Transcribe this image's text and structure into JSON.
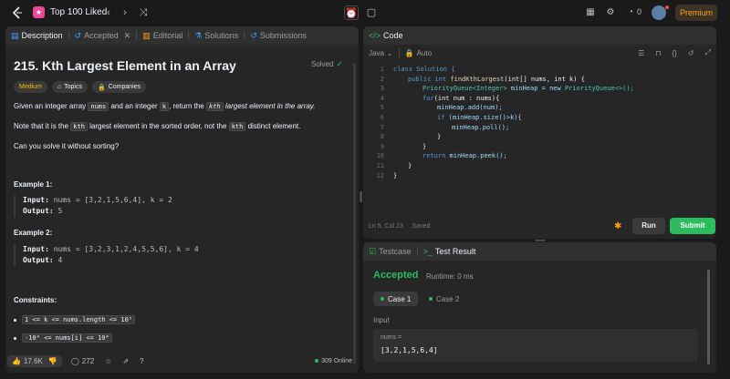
{
  "topbar": {
    "problem_list": "Top 100 Liked",
    "streak": "0",
    "premium": "Premium"
  },
  "description_panel": {
    "tabs": [
      "Description",
      "Accepted",
      "Editorial",
      "Solutions",
      "Submissions"
    ],
    "title": "215. Kth Largest Element in an Array",
    "status": "Solved",
    "tags": [
      "Medium",
      "Topics",
      "Companies"
    ],
    "para1": {
      "a": "Given an integer array ",
      "code1": "nums",
      "b": " and an integer ",
      "code2": "k",
      "c": ", return the ",
      "code3": "kth",
      "d": " largest element in the array."
    },
    "para2": {
      "a": "Note that it is the ",
      "code1": "kth",
      "b": " largest element in the sorted order, not the ",
      "code2": "kth",
      "c": " distinct element."
    },
    "para3": "Can you solve it without sorting?",
    "example1": {
      "heading": "Example 1:",
      "input_label": "Input:",
      "input": "nums = [3,2,1,5,6,4], k = 2",
      "output_label": "Output:",
      "output": "5"
    },
    "example2": {
      "heading": "Example 2:",
      "input_label": "Input:",
      "input": "nums = [3,2,3,1,2,4,5,5,6], k = 4",
      "output_label": "Output:",
      "output": "4"
    },
    "constraints_heading": "Constraints:",
    "constraints": [
      "1 <= k <= nums.length <= 10⁵",
      "-10⁴ <= nums[i] <= 10⁴"
    ],
    "likes": "17.6K",
    "comments": "272",
    "online": "309 Online"
  },
  "code_panel": {
    "tab": "Code",
    "language": "Java",
    "mode": "Auto",
    "lines": [
      {
        "n": "1"
      },
      {
        "n": "2"
      },
      {
        "n": "3"
      },
      {
        "n": "4"
      },
      {
        "n": "5"
      },
      {
        "n": "6"
      },
      {
        "n": "7"
      },
      {
        "n": "8"
      },
      {
        "n": "9"
      },
      {
        "n": "10"
      },
      {
        "n": "11"
      },
      {
        "n": "12"
      }
    ],
    "code": {
      "l1": "class Solution {",
      "l2a": "public",
      "l2b": "int",
      "l2c": "findKthLargest",
      "l2d": "(int[] nums, int k) {",
      "l3a": "PriorityQueue<Integer>",
      "l3b": " minHeap = new ",
      "l3c": "PriorityQueue<>();",
      "l4a": "for",
      "l4b": "(int num : nums){",
      "l5": "minHeap.add(num);",
      "l6a": "if",
      "l6b": " (minHeap.size()>k){",
      "l7": "minHeap.poll();",
      "l8": "}",
      "l9": "}",
      "l10a": "return",
      "l10b": " minHeap.peek();",
      "l11": "}",
      "l12": "}"
    },
    "status": "Ln 5, Col 23",
    "saved": "Saved",
    "run": "Run",
    "submit": "Submit"
  },
  "result_panel": {
    "tabs": [
      "Testcase",
      "Test Result"
    ],
    "verdict": "Accepted",
    "runtime": "Runtime: 0 ms",
    "cases": [
      "Case 1",
      "Case 2"
    ],
    "input_label": "Input",
    "input_name": "nums =",
    "input_value": "[3,2,1,5,6,4]"
  },
  "colors": {
    "accent": "#2cbb5d",
    "medium": "#ffb800",
    "premium": "#ffa116"
  }
}
